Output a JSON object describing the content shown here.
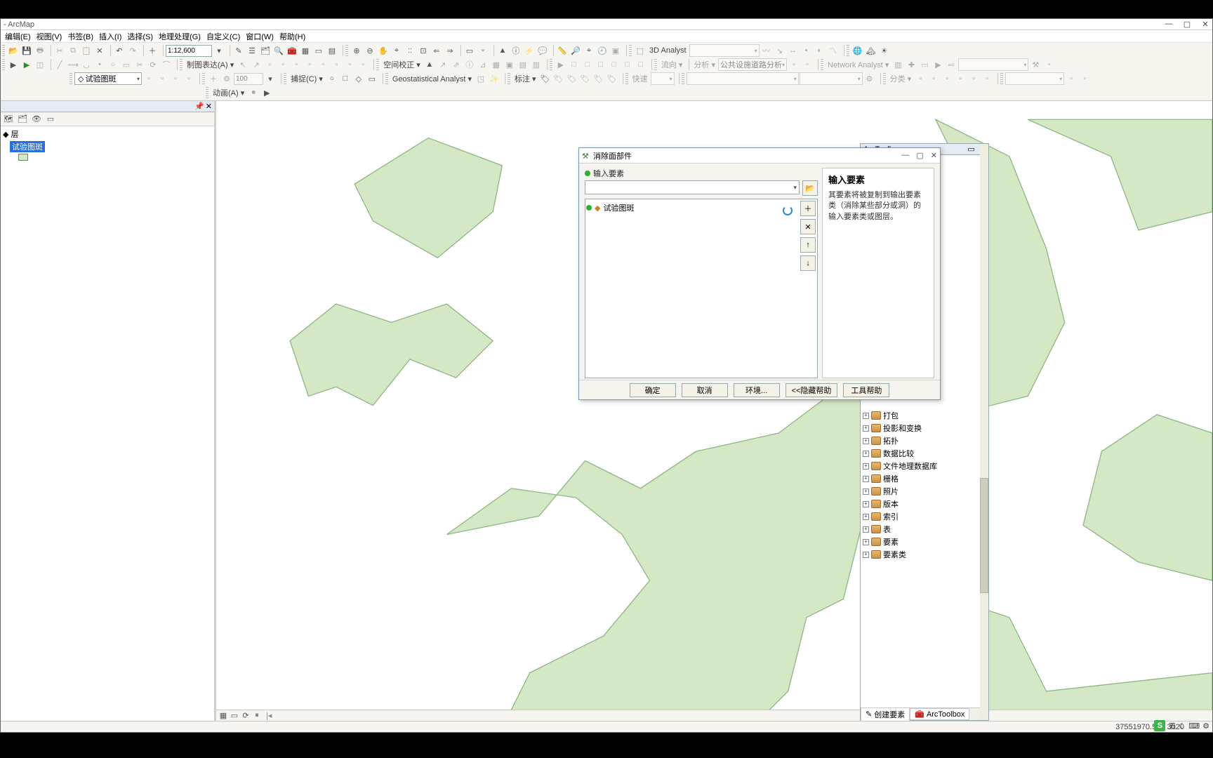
{
  "window": {
    "title": "- ArcMap",
    "min": "—",
    "max": "▢",
    "close": "✕"
  },
  "menu": [
    "编辑(E)",
    "视图(V)",
    "书签(B)",
    "插入(I)",
    "选择(S)",
    "地理处理(G)",
    "自定义(C)",
    "窗口(W)",
    "帮助(H)"
  ],
  "toolbar": {
    "scale": "1:12,600",
    "analyst3d": "3D Analyst",
    "networkAnalyst": "Network Analyst ▾",
    "graphicsLabel": "制图表达(A) ▾",
    "spatialAdj": "空间校正 ▾",
    "streamDir": "流向 ▾",
    "analysis": "分析 ▾",
    "serviceArea": "公共设施道路分析",
    "editorCombo": "试验图斑",
    "capture": "捕捉(C) ▾",
    "bufferDist": "100",
    "geostat": "Geostatistical Analyst ▾",
    "label": "标注 ▾",
    "quick": "快速",
    "class": "分类 ▾",
    "anim": "动画(A) ▾"
  },
  "toc": {
    "header": "",
    "group": "层",
    "layer": "试验图斑"
  },
  "atbx": {
    "title": "ArcToolbox",
    "nodes": [
      "打包",
      "投影和变换",
      "拓扑",
      "数据比较",
      "文件地理数据库",
      "栅格",
      "照片",
      "版本",
      "索引",
      "表",
      "要素",
      "要素类"
    ],
    "tabCreate": "创建要素",
    "tabToolbox": "ArcToolbox"
  },
  "dlg": {
    "title": "消除面部件",
    "param": "输入要素",
    "item": "试验图斑",
    "helpTitle": "输入要素",
    "helpBody": "其要素将被复制到输出要素类（消除某些部分或洞）的输入要素类或图层。",
    "ok": "确定",
    "cancel": "取消",
    "env": "环境...",
    "hideHelp": "<<隐藏帮助",
    "toolHelp": "工具帮助"
  },
  "status": {
    "coords": "37551970.505  3020"
  },
  "ime": {
    "letter": "S",
    "mode": "五"
  }
}
